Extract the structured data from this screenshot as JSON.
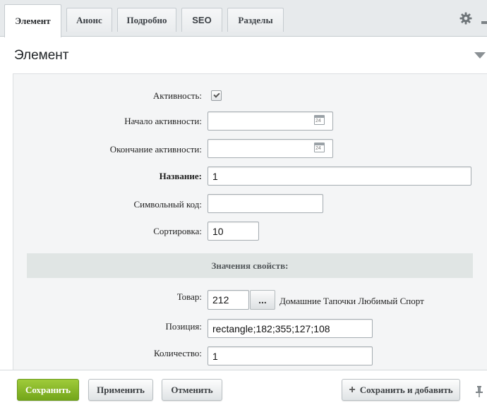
{
  "tabs": [
    {
      "label": "Элемент",
      "active": true
    },
    {
      "label": "Анонс",
      "active": false
    },
    {
      "label": "Подробно",
      "active": false
    },
    {
      "label": "SEO",
      "active": false
    },
    {
      "label": "Разделы",
      "active": false
    }
  ],
  "header": {
    "settings_icon": "gear-icon",
    "collapse_icon": "triangle-down-icon"
  },
  "section": {
    "title": "Элемент"
  },
  "form": {
    "active": {
      "label": "Активность:",
      "checked": true
    },
    "active_from": {
      "label": "Начало активности:",
      "value": "",
      "icon": "calendar-icon",
      "icon_text": "24"
    },
    "active_to": {
      "label": "Окончание активности:",
      "value": "",
      "icon": "calendar-icon",
      "icon_text": "24"
    },
    "name": {
      "label": "Название:",
      "value": "1"
    },
    "code": {
      "label": "Символьный код:",
      "value": ""
    },
    "sort": {
      "label": "Сортировка:",
      "value": "10"
    }
  },
  "properties": {
    "header": "Значения свойств:",
    "product": {
      "label": "Товар:",
      "value": "212",
      "button": "...",
      "name": "Домашние Тапочки Любимый Спорт"
    },
    "position": {
      "label": "Позиция:",
      "value": "rectangle;182;355;127;108"
    },
    "quantity": {
      "label": "Количество:",
      "value": "1"
    }
  },
  "footer": {
    "save": "Сохранить",
    "apply": "Применить",
    "cancel": "Отменить",
    "save_add": "Сохранить и добавить",
    "pin_icon": "pin-icon"
  },
  "colors": {
    "save_button": "#7fb126",
    "props_header_bg": "#e0e5e4",
    "panel_bg": "#f4f5f6"
  }
}
